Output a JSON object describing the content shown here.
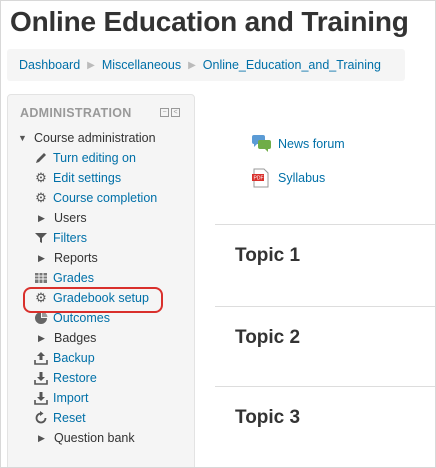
{
  "page": {
    "title": "Online Education and Training"
  },
  "breadcrumb": [
    "Dashboard",
    "Miscellaneous",
    "Online_Education_and_Training"
  ],
  "admin": {
    "heading": "ADMINISTRATION",
    "items": [
      {
        "label": "Course administration",
        "icon": "triangle-down-icon"
      },
      {
        "label": "Turn editing on",
        "icon": "pencil-icon"
      },
      {
        "label": "Edit settings",
        "icon": "gear-icon"
      },
      {
        "label": "Course completion",
        "icon": "gear-icon"
      },
      {
        "label": "Users",
        "icon": "triangle-right-icon"
      },
      {
        "label": "Filters",
        "icon": "filter-icon"
      },
      {
        "label": "Reports",
        "icon": "triangle-right-icon"
      },
      {
        "label": "Grades",
        "icon": "table-icon"
      },
      {
        "label": "Gradebook setup",
        "icon": "gear-icon"
      },
      {
        "label": "Outcomes",
        "icon": "pie-icon"
      },
      {
        "label": "Badges",
        "icon": "triangle-right-icon"
      },
      {
        "label": "Backup",
        "icon": "upload-icon"
      },
      {
        "label": "Restore",
        "icon": "download-icon"
      },
      {
        "label": "Import",
        "icon": "import-icon"
      },
      {
        "label": "Reset",
        "icon": "reset-icon"
      },
      {
        "label": "Question bank",
        "icon": "triangle-right-icon"
      }
    ]
  },
  "activities": [
    {
      "label": "News forum",
      "icon": "forum-icon"
    },
    {
      "label": "Syllabus",
      "icon": "pdf-icon"
    }
  ],
  "topics": [
    "Topic 1",
    "Topic 2",
    "Topic 3"
  ]
}
